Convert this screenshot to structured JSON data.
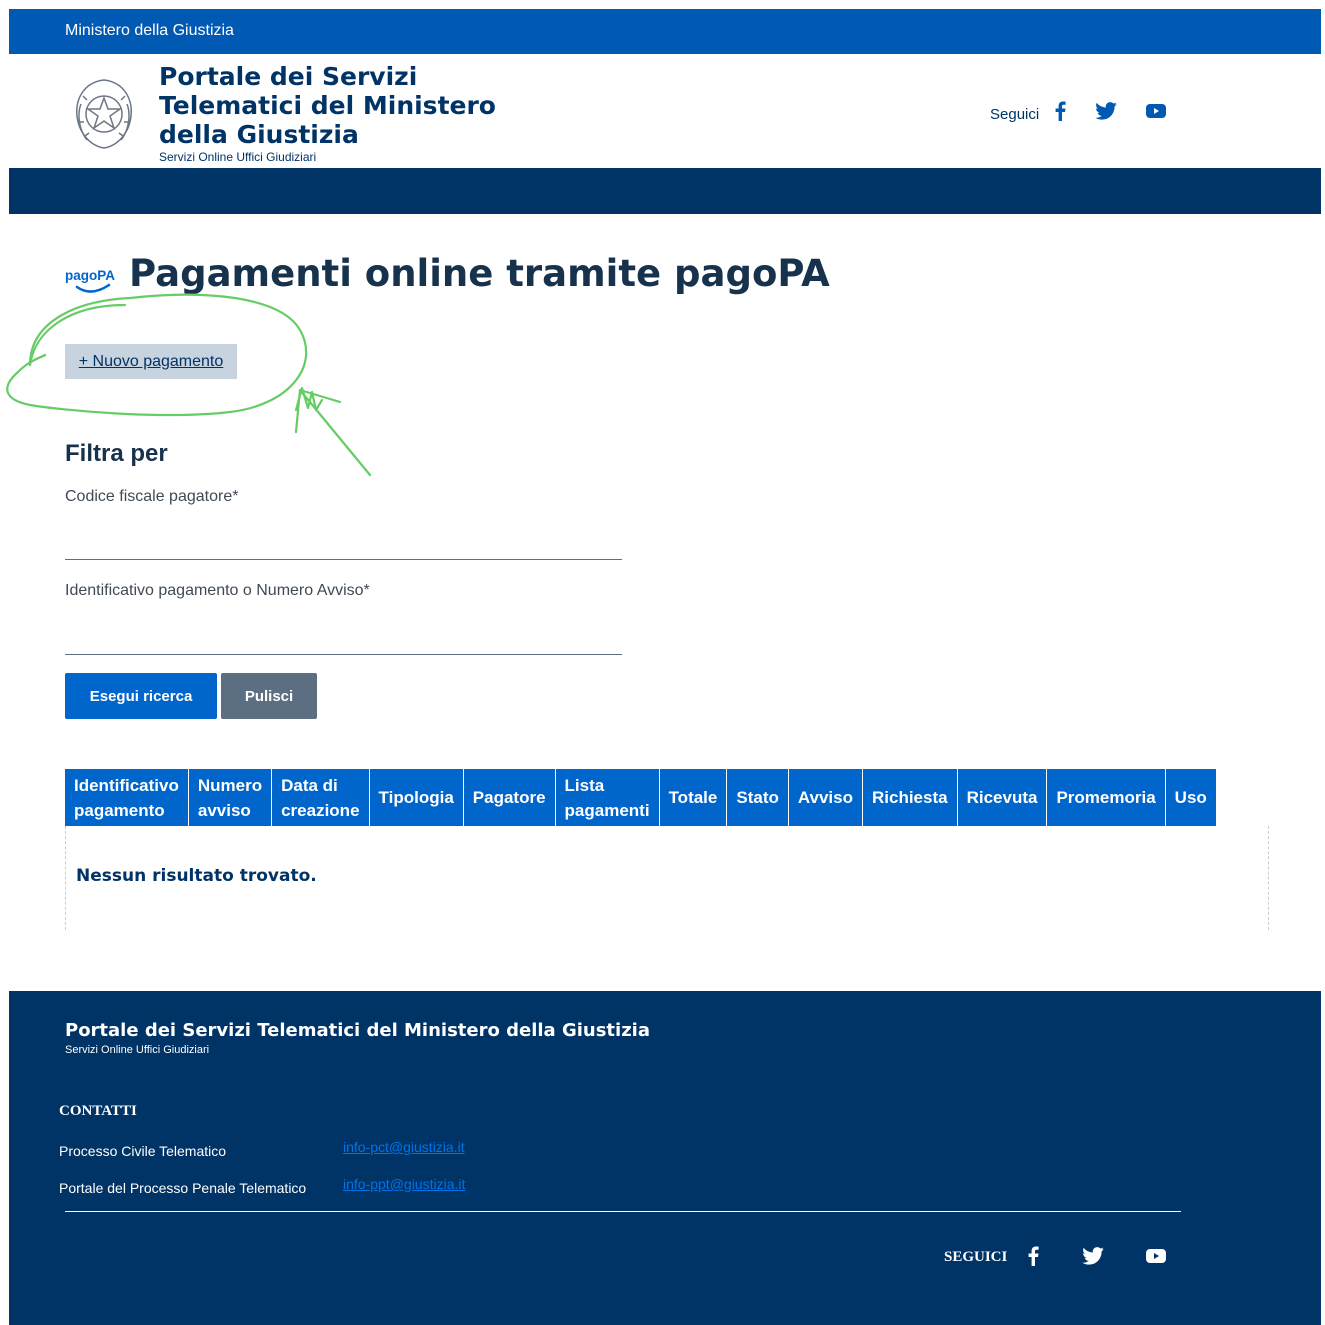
{
  "topbar": {
    "label": "Ministero della Giustizia"
  },
  "header": {
    "title": "Portale dei Servizi Telematici del Ministero della Giustizia",
    "subtitle": "Servizi Online Uffici Giudiziari",
    "follow_label": "Seguici",
    "social": [
      "facebook-icon",
      "twitter-icon",
      "youtube-icon"
    ]
  },
  "page": {
    "title": "Pagamenti online tramite pagoPA",
    "logo_text": "pagoPA",
    "new_payment_label": "+ Nuovo pagamento"
  },
  "filter": {
    "title": "Filtra per",
    "fields": [
      {
        "label": "Codice fiscale pagatore*",
        "value": "",
        "placeholder": ""
      },
      {
        "label": "Identificativo pagamento o Numero Avviso*",
        "value": "",
        "placeholder": ""
      }
    ],
    "search_label": "Esegui ricerca",
    "clear_label": "Pulisci"
  },
  "table": {
    "columns": [
      [
        "Identificativo",
        "pagamento"
      ],
      [
        "Numero",
        "avviso"
      ],
      [
        "Data di",
        "creazione"
      ],
      [
        "Tipologia"
      ],
      [
        "Pagatore"
      ],
      [
        "Lista",
        "pagamenti"
      ],
      [
        "Totale"
      ],
      [
        "Stato"
      ],
      [
        "Avviso"
      ],
      [
        "Richiesta"
      ],
      [
        "Ricevuta"
      ],
      [
        "Promemoria"
      ],
      [
        "Uso"
      ]
    ],
    "empty_message": "Nessun risultato trovato."
  },
  "footer": {
    "title": "Portale dei Servizi Telematici del Ministero della Giustizia",
    "subtitle": "Servizi Online Uffici Giudiziari",
    "contacts_title": "CONTATTI",
    "contacts": [
      {
        "label": "Processo Civile Telematico",
        "email": "info-pct@giustizia.it"
      },
      {
        "label": "Portale del Processo Penale Telematico",
        "email": "info-ppt@giustizia.it"
      }
    ],
    "follow_label": "SEGUICI"
  },
  "colors": {
    "topbar": "#0059b3",
    "navbar": "#003366",
    "primary": "#0066cc",
    "secondary": "#5c6f82",
    "annotation": "#66cc66"
  }
}
